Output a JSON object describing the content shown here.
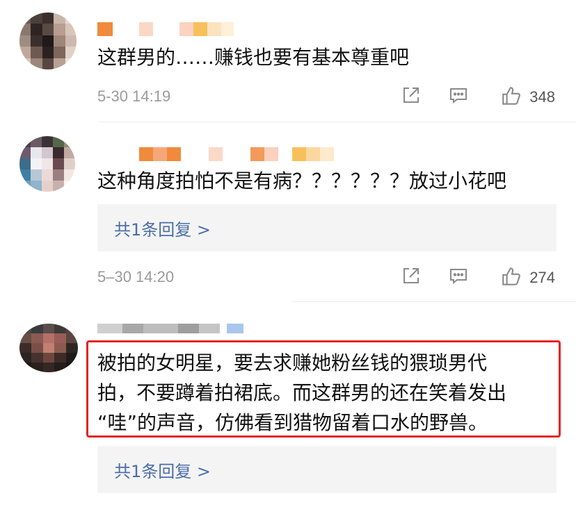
{
  "colors": {
    "highlight_border": "#e32522",
    "reply_link": "#4b6ea8",
    "meta_text": "#9a9a9a"
  },
  "comments": [
    {
      "text": "这群男的……赚钱也要有基本尊重吧",
      "time": "5-30 14:19",
      "likes": "348",
      "icons": [
        "share-icon",
        "comment-icon",
        "like-icon"
      ]
    },
    {
      "text": "这种角度拍怕不是有病？？？？？？放过小花吧",
      "reply_summary": "共1条回复 >",
      "time": "5–30 14:20",
      "likes": "274",
      "icons": [
        "share-icon",
        "comment-icon",
        "like-icon"
      ]
    },
    {
      "text_lines": [
        "被拍的女明星，要去求赚她粉丝钱的猥琐男代",
        "拍，不要蹲着拍裙底。而这群男的还在笑着发出",
        "“哇”的声音，仿佛看到猎物留着口水的野兽。"
      ],
      "reply_summary": "共1条回复 >"
    }
  ]
}
